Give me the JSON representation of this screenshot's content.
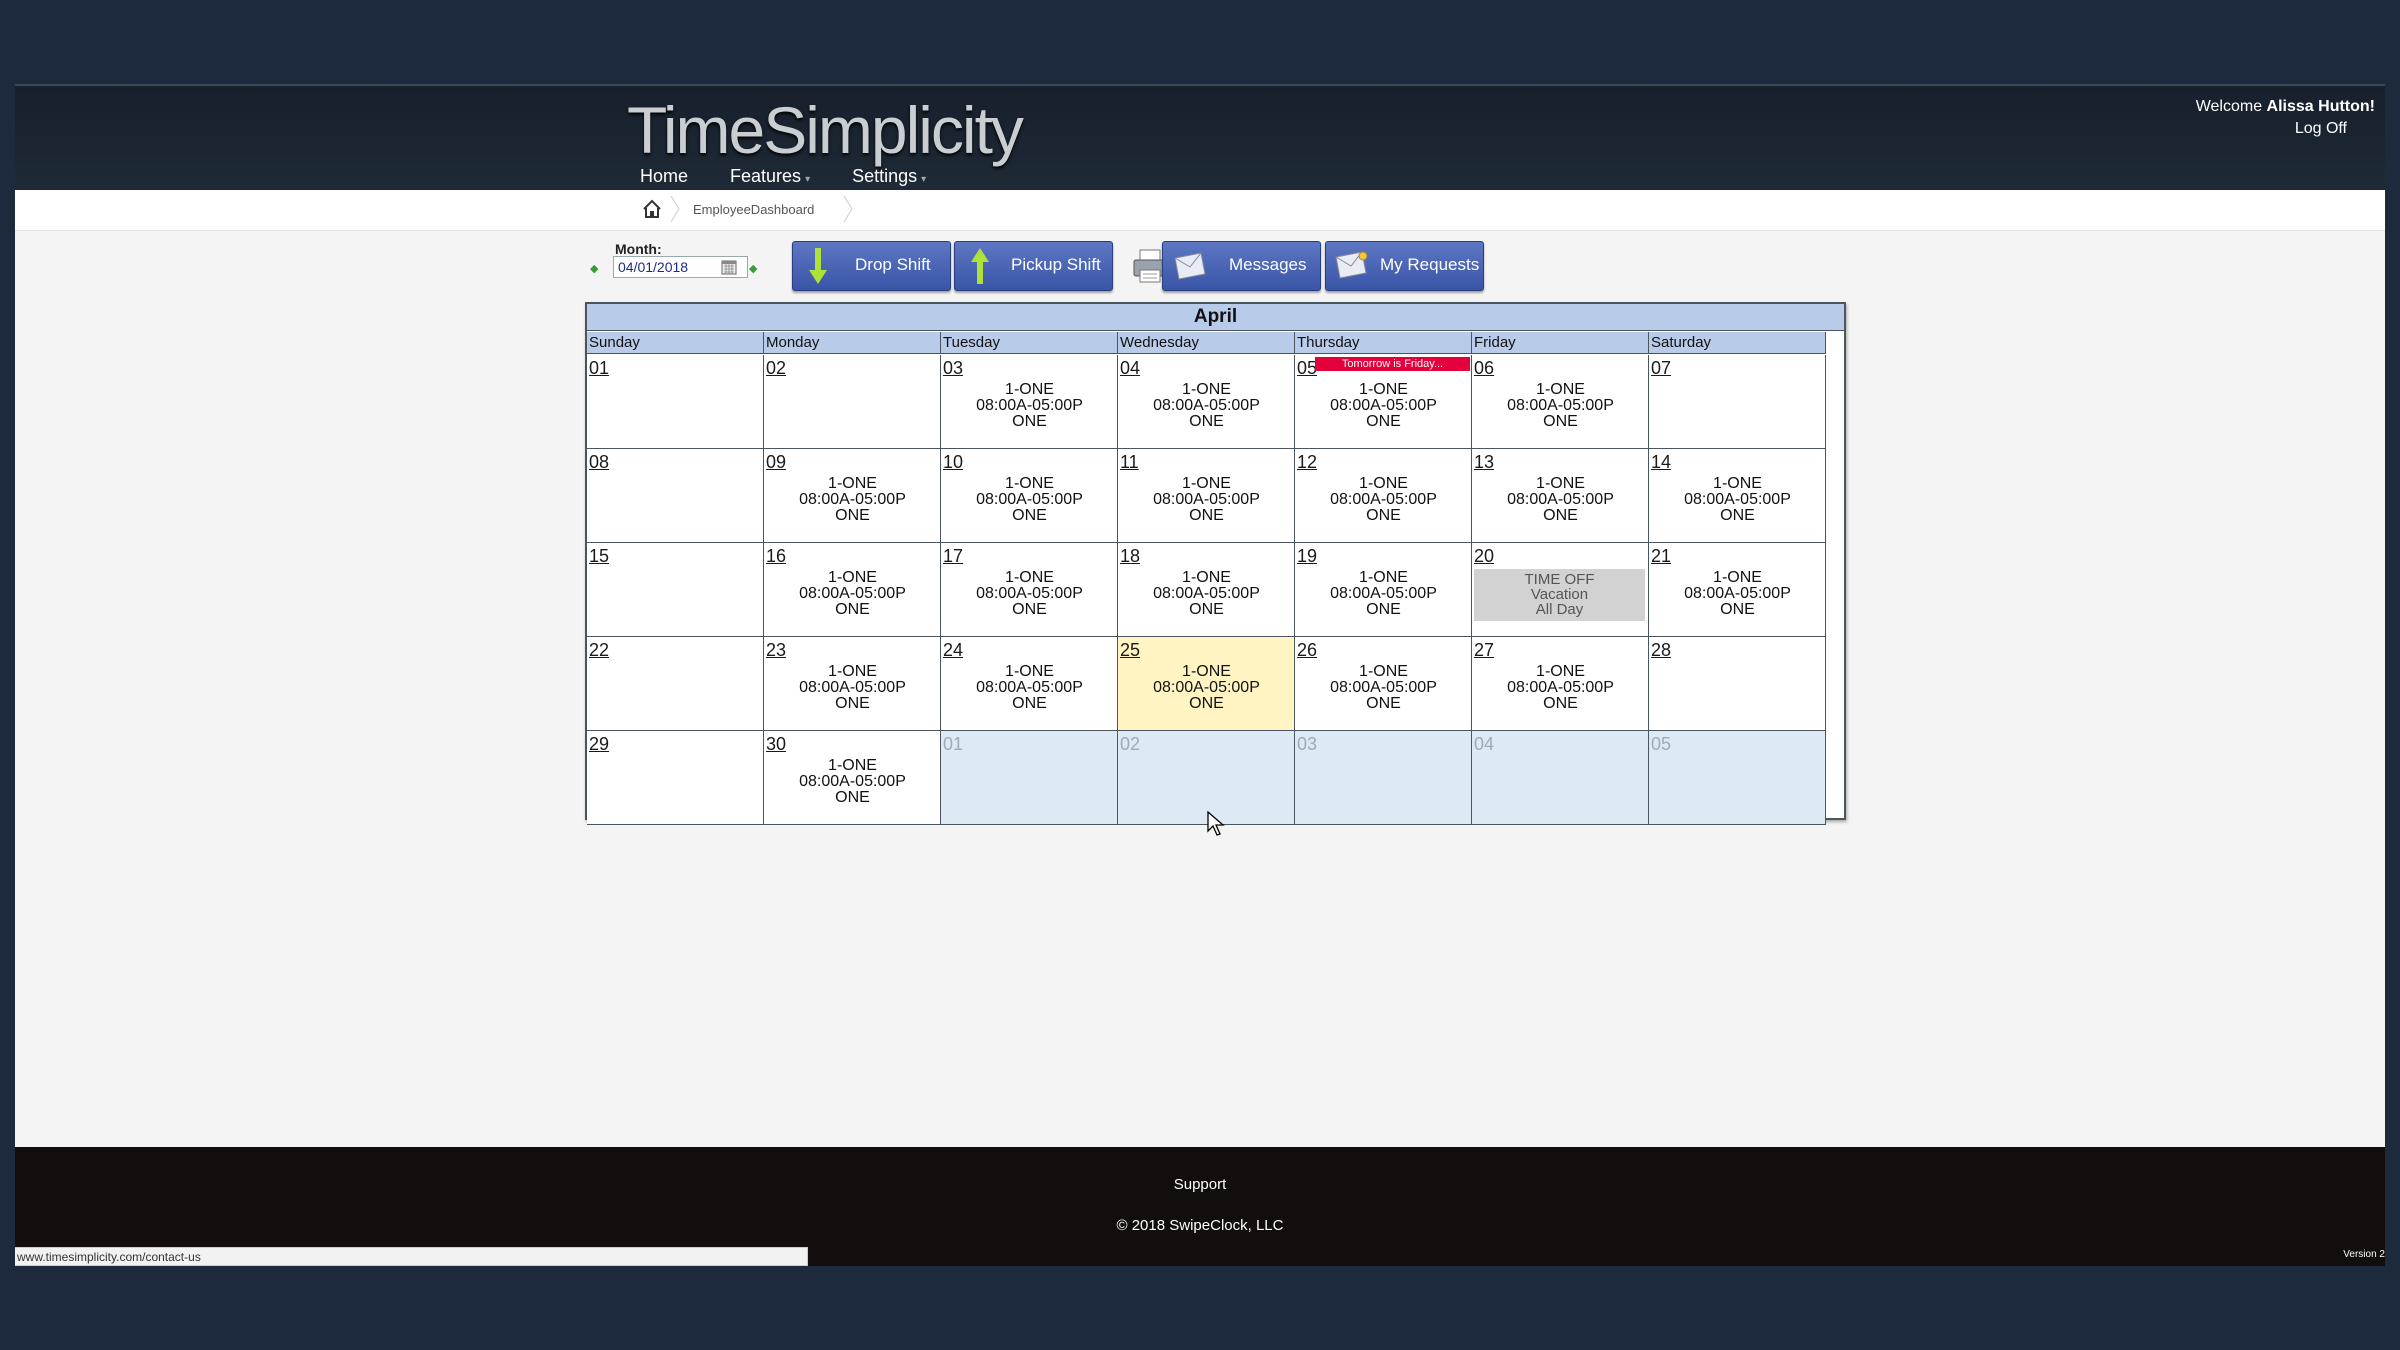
{
  "header": {
    "logo": "TimeSimplicity",
    "nav": [
      "Home",
      "Features",
      "Settings"
    ],
    "welcome_prefix": "Welcome ",
    "user_name": "Alissa Hutton!",
    "logoff": "Log Off"
  },
  "breadcrumb": {
    "page": "EmployeeDashboard"
  },
  "toolbar": {
    "month_label": "Month:",
    "month_value": "04/01/2018",
    "drop_shift": "Drop Shift",
    "pickup_shift": "Pickup Shift",
    "messages": "Messages",
    "my_requests": "My Requests"
  },
  "calendar": {
    "title": "April",
    "weekdays": [
      "Sunday",
      "Monday",
      "Tuesday",
      "Wednesday",
      "Thursday",
      "Friday",
      "Saturday"
    ],
    "weeks": [
      [
        {
          "day": "01"
        },
        {
          "day": "02"
        },
        {
          "day": "03",
          "shift": [
            "1-ONE",
            "08:00A-05:00P",
            "ONE"
          ]
        },
        {
          "day": "04",
          "shift": [
            "1-ONE",
            "08:00A-05:00P",
            "ONE"
          ]
        },
        {
          "day": "05",
          "event": "Tomorrow is Friday...",
          "shift": [
            "1-ONE",
            "08:00A-05:00P",
            "ONE"
          ]
        },
        {
          "day": "06",
          "shift": [
            "1-ONE",
            "08:00A-05:00P",
            "ONE"
          ]
        },
        {
          "day": "07"
        }
      ],
      [
        {
          "day": "08"
        },
        {
          "day": "09",
          "shift": [
            "1-ONE",
            "08:00A-05:00P",
            "ONE"
          ]
        },
        {
          "day": "10",
          "shift": [
            "1-ONE",
            "08:00A-05:00P",
            "ONE"
          ]
        },
        {
          "day": "11",
          "shift": [
            "1-ONE",
            "08:00A-05:00P",
            "ONE"
          ]
        },
        {
          "day": "12",
          "shift": [
            "1-ONE",
            "08:00A-05:00P",
            "ONE"
          ]
        },
        {
          "day": "13",
          "shift": [
            "1-ONE",
            "08:00A-05:00P",
            "ONE"
          ]
        },
        {
          "day": "14",
          "shift": [
            "1-ONE",
            "08:00A-05:00P",
            "ONE"
          ]
        }
      ],
      [
        {
          "day": "15"
        },
        {
          "day": "16",
          "shift": [
            "1-ONE",
            "08:00A-05:00P",
            "ONE"
          ]
        },
        {
          "day": "17",
          "shift": [
            "1-ONE",
            "08:00A-05:00P",
            "ONE"
          ]
        },
        {
          "day": "18",
          "shift": [
            "1-ONE",
            "08:00A-05:00P",
            "ONE"
          ]
        },
        {
          "day": "19",
          "shift": [
            "1-ONE",
            "08:00A-05:00P",
            "ONE"
          ]
        },
        {
          "day": "20",
          "timeoff": [
            "TIME OFF",
            "Vacation",
            "All Day"
          ]
        },
        {
          "day": "21",
          "shift": [
            "1-ONE",
            "08:00A-05:00P",
            "ONE"
          ]
        }
      ],
      [
        {
          "day": "22"
        },
        {
          "day": "23",
          "shift": [
            "1-ONE",
            "08:00A-05:00P",
            "ONE"
          ]
        },
        {
          "day": "24",
          "shift": [
            "1-ONE",
            "08:00A-05:00P",
            "ONE"
          ]
        },
        {
          "day": "25",
          "today": true,
          "shift": [
            "1-ONE",
            "08:00A-05:00P",
            "ONE"
          ]
        },
        {
          "day": "26",
          "shift": [
            "1-ONE",
            "08:00A-05:00P",
            "ONE"
          ]
        },
        {
          "day": "27",
          "shift": [
            "1-ONE",
            "08:00A-05:00P",
            "ONE"
          ]
        },
        {
          "day": "28"
        }
      ],
      [
        {
          "day": "29"
        },
        {
          "day": "30",
          "shift": [
            "1-ONE",
            "08:00A-05:00P",
            "ONE"
          ]
        },
        {
          "day": "01",
          "other": true
        },
        {
          "day": "02",
          "other": true
        },
        {
          "day": "03",
          "other": true
        },
        {
          "day": "04",
          "other": true
        },
        {
          "day": "05",
          "other": true
        }
      ]
    ]
  },
  "footer": {
    "support": "Support",
    "copyright": "© 2018 SwipeClock, LLC",
    "version": "Version 2"
  },
  "statusbar": {
    "url": "www.timesimplicity.com/contact-us"
  },
  "colors": {
    "accent": "#3a55a6",
    "header_bg": "#1a2430",
    "calendar_header": "#b8cbe9",
    "event_red": "#e4003a",
    "today_yellow": "#fff4c2",
    "timeoff_gray": "#d2d2d2"
  }
}
